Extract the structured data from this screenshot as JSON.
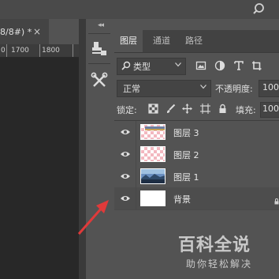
{
  "document": {
    "tab_title": "8/8#) *",
    "close_label": "×"
  },
  "ruler": {
    "labels": [
      "0",
      "1700",
      "1800"
    ]
  },
  "tool_column": {
    "collapse_label": "◂◂",
    "tools": [
      "clone-stamp-icon",
      "tools-icon"
    ]
  },
  "panel": {
    "tabs": [
      "图层",
      "通道",
      "路径"
    ],
    "filter": {
      "label": "类型",
      "icons": [
        "image-filter-icon",
        "adjustment-filter-icon",
        "type-filter-icon",
        "shape-filter-icon"
      ]
    },
    "blend_mode": "正常",
    "opacity_label": "不透明度:",
    "opacity_value": "100",
    "lock_label": "锁定:",
    "lock_icons": [
      "lock-transparent-icon",
      "lock-paint-icon",
      "lock-move-icon",
      "lock-artboard-icon",
      "lock-all-icon"
    ],
    "fill_label": "填充:",
    "fill_value": "100"
  },
  "layers": [
    {
      "name": "图层 3",
      "thumbnail": "checker-with-photo-strip"
    },
    {
      "name": "图层 2",
      "thumbnail": "checker"
    },
    {
      "name": "图层 1",
      "thumbnail": "photo"
    },
    {
      "name": "背景",
      "thumbnail": "white"
    }
  ],
  "watermark": {
    "main": "百科全说",
    "sub": "助你轻松解决"
  },
  "colors": {
    "panel": "#535353",
    "tab_bar": "#424242",
    "canvas": "#282828",
    "arrow": "#e03a3a",
    "checker_pink": "#f3b8c0"
  }
}
